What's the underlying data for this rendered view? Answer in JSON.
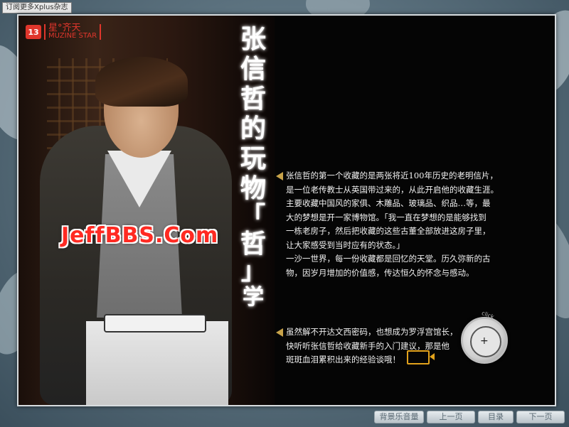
{
  "top_link": "订阅更多Xplus杂志",
  "magazine": {
    "issue_number": "13",
    "brand_cn": "星°齐天",
    "brand_en": "MUZINE STAR"
  },
  "watermark": "JeffBBS.Com",
  "title_chars": [
    "张",
    "信",
    "哲",
    "的",
    "玩",
    "物",
    "「",
    "哲",
    "」",
    "学"
  ],
  "paragraph1": [
    "张信哲的第一个收藏的是两张将近100年历史的老明信片，",
    "是一位老传教士从英国带过来的，从此开启他的收藏生涯。",
    "主要收藏中国风的家俱、木雕品、玻璃品、织品…等，最",
    "大的梦想是开一家博物馆。「我一直在梦想的是能够找到",
    "一栋老房子，然后把收藏的这些古董全部放进这房子里，",
    "让大家感受到当时应有的状态。」",
    "一沙一世界，每一份收藏都是回忆的天堂。历久弥新的古",
    "物，因岁月增加的价值感，传达恒久的怀念与感动。"
  ],
  "paragraph2": [
    "虽然解不开达文西密码，也想成为罗浮宫馆长，",
    "快听听张信哲给收藏新手的入门建议，那是他",
    "斑斑血泪累积出来的经验谈哦！"
  ],
  "click_label": "click",
  "nav": {
    "music": "背景乐音量",
    "prev": "上一页",
    "toc": "目录",
    "next": "下一页"
  }
}
